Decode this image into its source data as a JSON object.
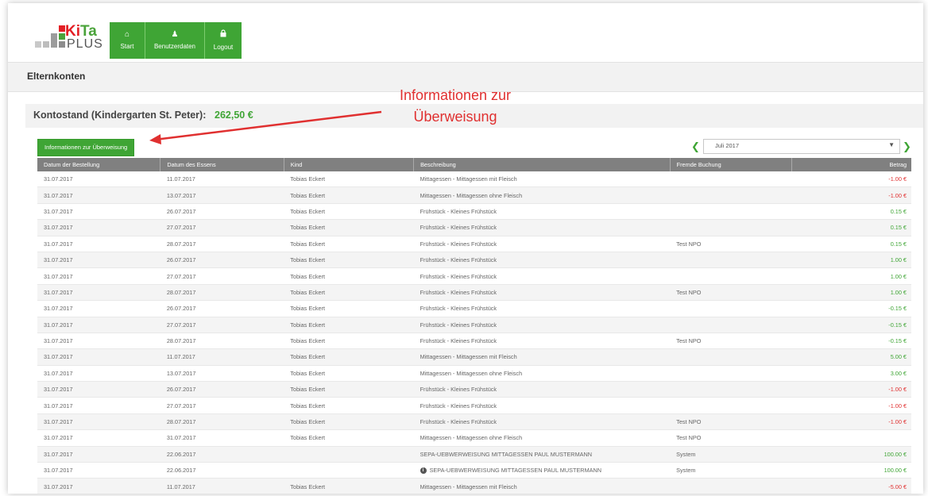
{
  "brand": {
    "logo_ki": "Ki",
    "logo_ta": "Ta",
    "logo_plus": "PLUS",
    "colors": {
      "green": "#3fa535",
      "red": "#e31e24",
      "header_gray": "#808080"
    }
  },
  "nav": [
    {
      "label": "Start",
      "icon": "home-icon"
    },
    {
      "label": "Benutzerdaten",
      "icon": "user-icon"
    },
    {
      "label": "Logout",
      "icon": "lock-icon"
    }
  ],
  "page_title": "Elternkonten",
  "balance": {
    "label": "Kontostand (Kindergarten St. Peter):",
    "amount": "262,50 €"
  },
  "annotation": {
    "line1": "Informationen zur",
    "line2": "Überweisung"
  },
  "info_button_label": "Informationen zur Überweisung",
  "month": {
    "selected": "Juli 2017"
  },
  "table": {
    "headers": [
      "Datum der Bestellung",
      "Datum des Essens",
      "Kind",
      "Beschreibung",
      "Fremde Buchung",
      "Betrag"
    ],
    "rows": [
      {
        "order": "31.07.2017",
        "meal": "11.07.2017",
        "child": "Tobias Eckert",
        "desc": "Mittagessen - Mittagessen mit Fleisch",
        "foreign": "",
        "amount": "-1.00 €",
        "sign": "neg",
        "info": false
      },
      {
        "order": "31.07.2017",
        "meal": "13.07.2017",
        "child": "Tobias Eckert",
        "desc": "Mittagessen - Mittagessen ohne Fleisch",
        "foreign": "",
        "amount": "-1.00 €",
        "sign": "neg",
        "info": false
      },
      {
        "order": "31.07.2017",
        "meal": "26.07.2017",
        "child": "Tobias Eckert",
        "desc": "Frühstück - Kleines Frühstück",
        "foreign": "",
        "amount": "0.15 €",
        "sign": "pos",
        "info": false
      },
      {
        "order": "31.07.2017",
        "meal": "27.07.2017",
        "child": "Tobias Eckert",
        "desc": "Frühstück - Kleines Frühstück",
        "foreign": "",
        "amount": "0.15 €",
        "sign": "pos",
        "info": false
      },
      {
        "order": "31.07.2017",
        "meal": "28.07.2017",
        "child": "Tobias Eckert",
        "desc": "Frühstück - Kleines Frühstück",
        "foreign": "Test NPO",
        "amount": "0.15 €",
        "sign": "pos",
        "info": false
      },
      {
        "order": "31.07.2017",
        "meal": "26.07.2017",
        "child": "Tobias Eckert",
        "desc": "Frühstück - Kleines Frühstück",
        "foreign": "",
        "amount": "1.00 €",
        "sign": "pos",
        "info": false
      },
      {
        "order": "31.07.2017",
        "meal": "27.07.2017",
        "child": "Tobias Eckert",
        "desc": "Frühstück - Kleines Frühstück",
        "foreign": "",
        "amount": "1.00 €",
        "sign": "pos",
        "info": false
      },
      {
        "order": "31.07.2017",
        "meal": "28.07.2017",
        "child": "Tobias Eckert",
        "desc": "Frühstück - Kleines Frühstück",
        "foreign": "Test NPO",
        "amount": "1.00 €",
        "sign": "pos",
        "info": false
      },
      {
        "order": "31.07.2017",
        "meal": "26.07.2017",
        "child": "Tobias Eckert",
        "desc": "Frühstück - Kleines Frühstück",
        "foreign": "",
        "amount": "-0.15 €",
        "sign": "pos",
        "info": false
      },
      {
        "order": "31.07.2017",
        "meal": "27.07.2017",
        "child": "Tobias Eckert",
        "desc": "Frühstück - Kleines Frühstück",
        "foreign": "",
        "amount": "-0.15 €",
        "sign": "pos",
        "info": false
      },
      {
        "order": "31.07.2017",
        "meal": "28.07.2017",
        "child": "Tobias Eckert",
        "desc": "Frühstück - Kleines Frühstück",
        "foreign": "Test NPO",
        "amount": "-0.15 €",
        "sign": "pos",
        "info": false
      },
      {
        "order": "31.07.2017",
        "meal": "11.07.2017",
        "child": "Tobias Eckert",
        "desc": "Mittagessen - Mittagessen mit Fleisch",
        "foreign": "",
        "amount": "5.00 €",
        "sign": "pos",
        "info": false
      },
      {
        "order": "31.07.2017",
        "meal": "13.07.2017",
        "child": "Tobias Eckert",
        "desc": "Mittagessen - Mittagessen ohne Fleisch",
        "foreign": "",
        "amount": "3.00 €",
        "sign": "pos",
        "info": false
      },
      {
        "order": "31.07.2017",
        "meal": "26.07.2017",
        "child": "Tobias Eckert",
        "desc": "Frühstück - Kleines Frühstück",
        "foreign": "",
        "amount": "-1.00 €",
        "sign": "neg",
        "info": false
      },
      {
        "order": "31.07.2017",
        "meal": "27.07.2017",
        "child": "Tobias Eckert",
        "desc": "Frühstück - Kleines Frühstück",
        "foreign": "",
        "amount": "-1.00 €",
        "sign": "neg",
        "info": false
      },
      {
        "order": "31.07.2017",
        "meal": "28.07.2017",
        "child": "Tobias Eckert",
        "desc": "Frühstück - Kleines Frühstück",
        "foreign": "Test NPO",
        "amount": "-1.00 €",
        "sign": "neg",
        "info": false
      },
      {
        "order": "31.07.2017",
        "meal": "31.07.2017",
        "child": "Tobias Eckert",
        "desc": "Mittagessen - Mittagessen ohne Fleisch",
        "foreign": "Test NPO",
        "amount": "",
        "sign": "pos",
        "info": false
      },
      {
        "order": "31.07.2017",
        "meal": "22.06.2017",
        "child": "",
        "desc": "SEPA-UEBWERWEISUNG MITTAGESSEN PAUL MUSTERMANN",
        "foreign": "System",
        "amount": "100.00 €",
        "sign": "pos",
        "info": false
      },
      {
        "order": "31.07.2017",
        "meal": "22.06.2017",
        "child": "",
        "desc": "SEPA-UEBWERWEISUNG MITTAGESSEN PAUL MUSTERMANN",
        "foreign": "System",
        "amount": "100.00 €",
        "sign": "pos",
        "info": true
      },
      {
        "order": "31.07.2017",
        "meal": "11.07.2017",
        "child": "Tobias Eckert",
        "desc": "Mittagessen - Mittagessen mit Fleisch",
        "foreign": "",
        "amount": "-5.00 €",
        "sign": "neg",
        "info": false
      }
    ]
  }
}
